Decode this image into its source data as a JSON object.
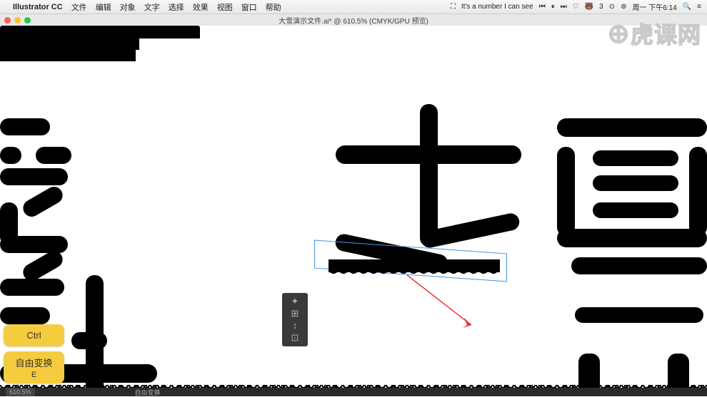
{
  "menubar": {
    "apple": "",
    "app_name": "Illustrator CC",
    "items": [
      "文件",
      "编辑",
      "对象",
      "文字",
      "选择",
      "效果",
      "视图",
      "窗口",
      "帮助"
    ],
    "right": {
      "now_playing": "It's a number I can see",
      "badge": "3",
      "day_time": "周一 下午6:14"
    }
  },
  "document": {
    "title": "大雪演示文件.ai* @ 610.5% (CMYK/GPU 预览)"
  },
  "statusbar": {
    "zoom": "610.5%",
    "info": "自由变换"
  },
  "key_hints": {
    "ctrl": "Ctrl",
    "transform_label": "自由变换",
    "transform_key": "E"
  },
  "watermark": "虎课网",
  "tool_icons": [
    "✦",
    "⊞",
    "↕",
    "⊡"
  ]
}
